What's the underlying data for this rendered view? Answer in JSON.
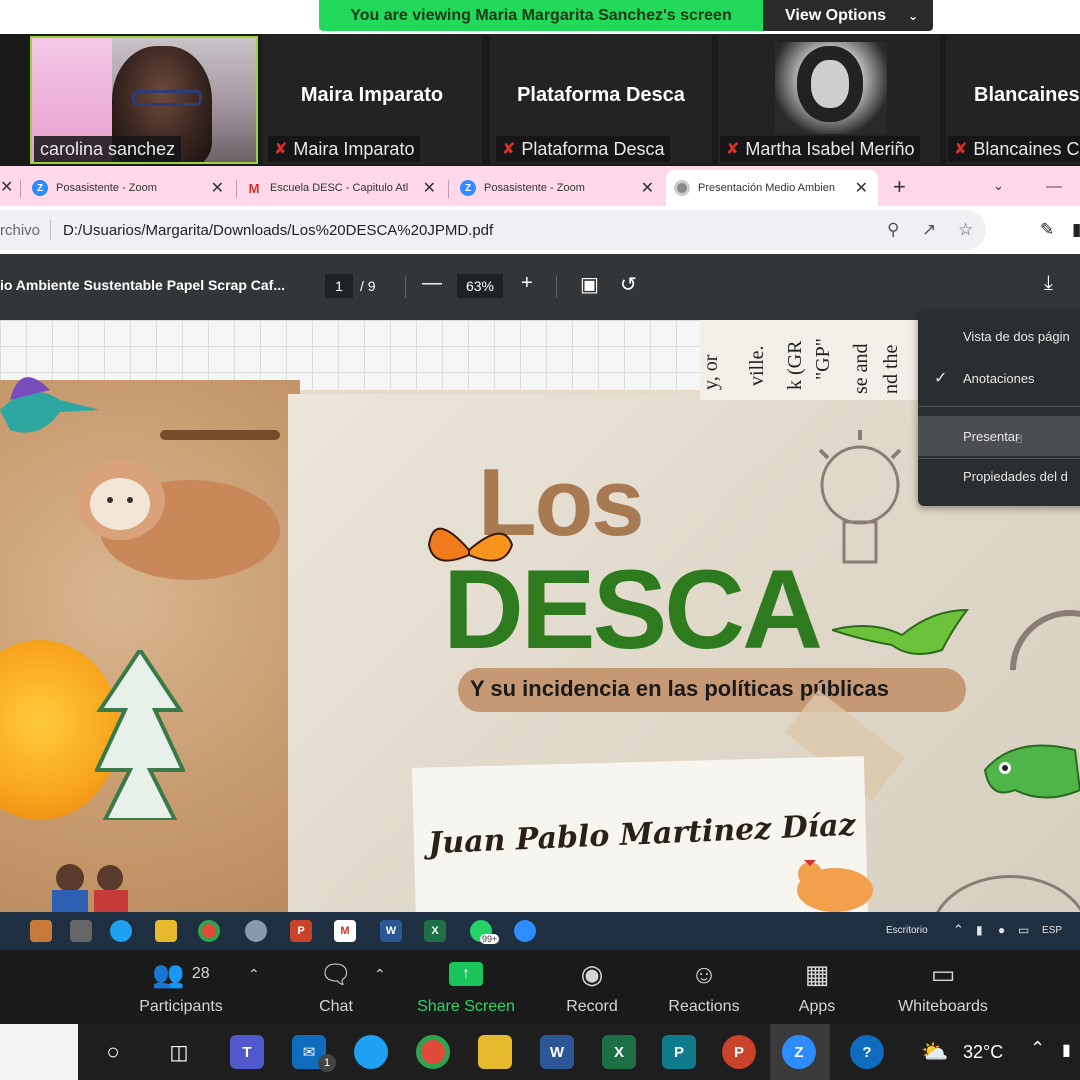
{
  "zoom": {
    "share_banner": "You are viewing Maria Margarita Sanchez's screen",
    "view_options": "View Options",
    "participants": [
      {
        "name": "carolina sanchez",
        "has_video": true
      },
      {
        "name": "Maira Imparato",
        "tile_name": "Maira Imparato",
        "muted": true
      },
      {
        "name": "Plataforma Desca",
        "tile_name": "Plataforma Desca",
        "muted": true
      },
      {
        "name": "Martha Isabel Meriño",
        "muted": true,
        "has_photo": true
      },
      {
        "name": "Blancaines C",
        "tile_name": "Blancaines",
        "muted": true
      }
    ],
    "controls": {
      "participants_label": "Participants",
      "participants_count": "28",
      "chat_label": "Chat",
      "share_label": "Share Screen",
      "record_label": "Record",
      "reactions_label": "Reactions",
      "apps_label": "Apps",
      "whiteboards_label": "Whiteboards"
    }
  },
  "browser": {
    "tabs": [
      {
        "title": "Posasistente - Zoom",
        "icon": "zoom-icon"
      },
      {
        "title": "Escuela DESC - Capitulo Atl",
        "icon": "gmail-icon"
      },
      {
        "title": "Posasistente - Zoom",
        "icon": "zoom-icon"
      },
      {
        "title": "Presentación Medio Ambien",
        "icon": "chrome-icon",
        "active": true
      }
    ],
    "address_label": "rchivo",
    "url": "D:/Usuarios/Margarita/Downloads/Los%20DESCA%20JPMD.pdf"
  },
  "pdf": {
    "title": "io Ambiente Sustentable Papel Scrap Caf...",
    "page": "1",
    "total": "/  9",
    "zoom": "63%",
    "menu": {
      "items": [
        {
          "label": "Vista de dos págin",
          "checked": false
        },
        {
          "label": "Anotaciones",
          "checked": true
        },
        {
          "label": "Presentar",
          "checked": false,
          "hovered": true
        },
        {
          "label": "Propiedades del d",
          "checked": false
        }
      ]
    }
  },
  "slide": {
    "title_small": "Los",
    "title_big": "DESCA",
    "subtitle": "Y su incidencia en las políticas públicas",
    "author": "Juan Pablo Martinez Díaz",
    "newspaper_lines": [
      "y, or",
      "ville.",
      "k (GR",
      "\"GP\"",
      "se and",
      "nd the"
    ]
  },
  "taskbar_small": {
    "desktop_label": "Escritorio",
    "lang": "ESP",
    "badge": "99+"
  },
  "taskbar": {
    "temperature": "32°C",
    "mail_badge": "1"
  },
  "colors": {
    "banner_green": "#23d959",
    "share_green": "#1bc45a",
    "desca_green": "#2e7a1f",
    "los_brown": "#a87a52",
    "tab_pink": "#ffd8ea",
    "mute_red": "#e0302c"
  }
}
